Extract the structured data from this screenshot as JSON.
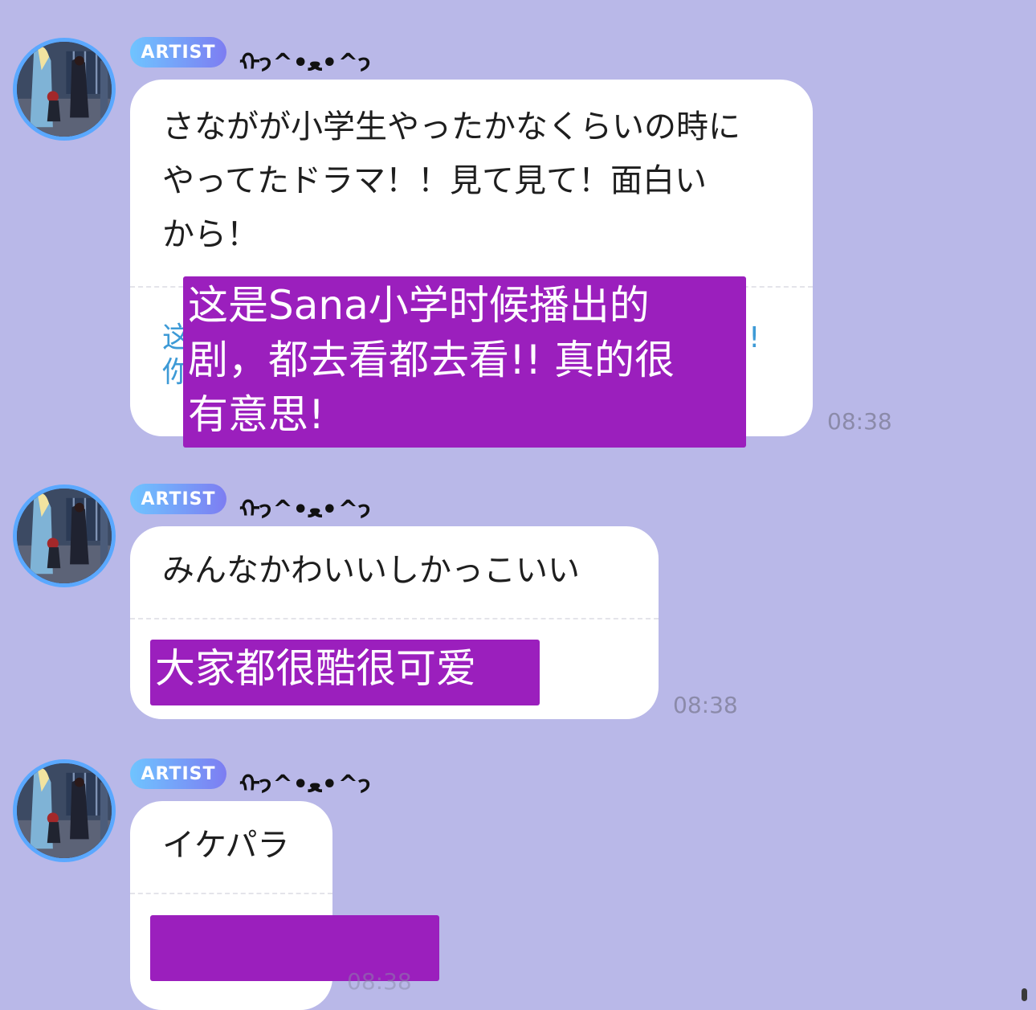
{
  "colors": {
    "background": "#b9b8e8",
    "bubble": "#ffffff",
    "badge_gradient_start": "#6fc4ff",
    "badge_gradient_end": "#7d7df2",
    "avatar_ring": "#5aa8ff",
    "overlay": "#9b1fbd",
    "translation_text": "#3d9ad6",
    "time_text": "#8b8aa9"
  },
  "messages": [
    {
      "badge": "ARTIST",
      "sender": "ᡣ𐭩^•ﻌ•^𐭩",
      "text": "さながが小学生やったかなくらいの時に\nやってたドラマ！！見て見て！面白い\nから！",
      "translation_partial": "这\n你",
      "translation_tail": "!",
      "overlay_text": "这是Sana小学时候播出的\n剧，都去看都去看!! 真的很\n有意思!",
      "time": "08:38",
      "avatar_icon": "anime-scene-avatar-icon"
    },
    {
      "badge": "ARTIST",
      "sender": "ᡣ𐭩^•ﻌ•^𐭩",
      "text": "みんなかわいいしかっこいい",
      "overlay_text": "大家都很酷很可爱",
      "time": "08:38",
      "avatar_icon": "anime-scene-avatar-icon"
    },
    {
      "badge": "ARTIST",
      "sender": "ᡣ𐭩^•ﻌ•^𐭩",
      "text": "イケパラ",
      "overlay_text": "",
      "time": "08:38",
      "avatar_icon": "anime-scene-avatar-icon"
    }
  ]
}
